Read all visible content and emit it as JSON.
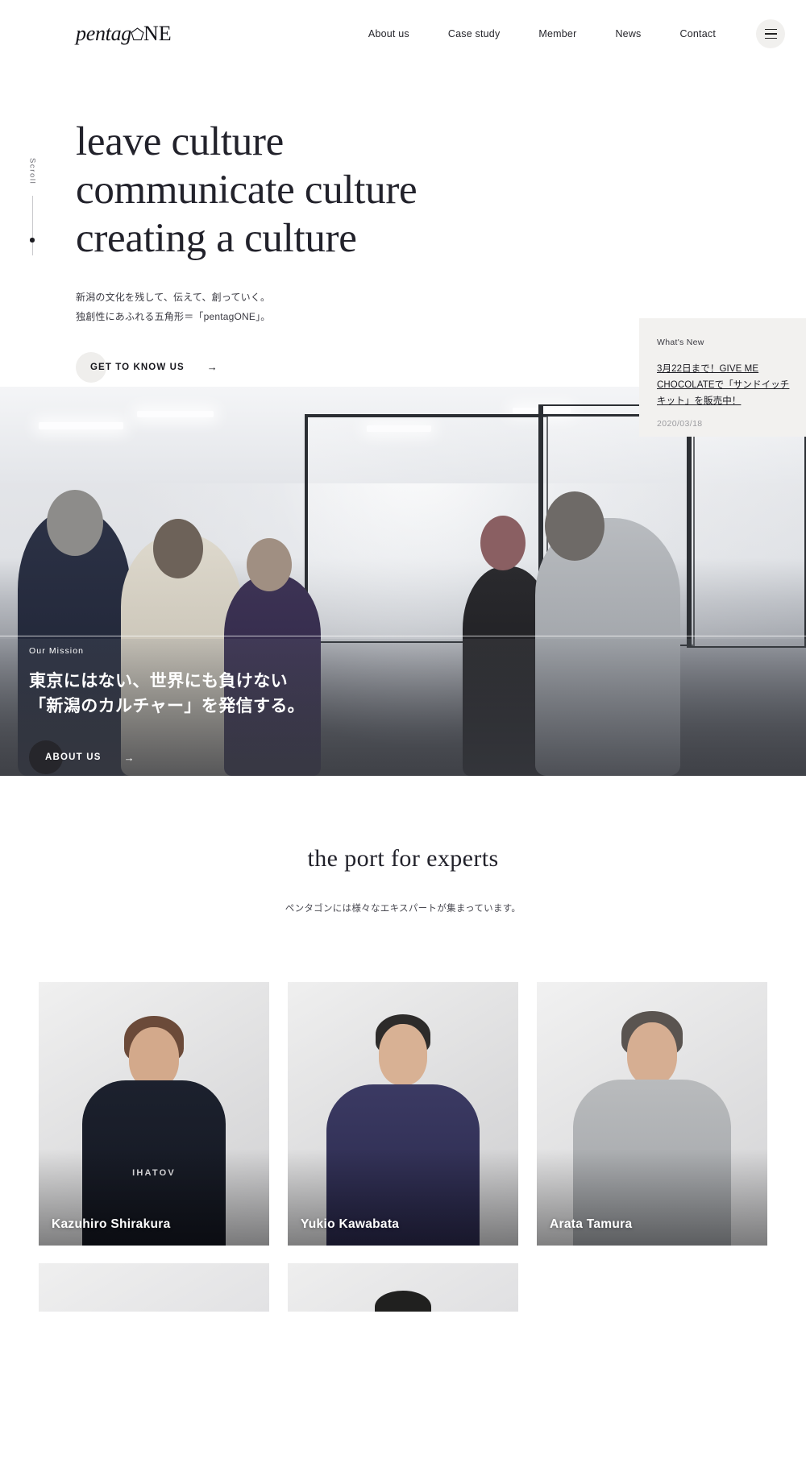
{
  "header": {
    "logo": {
      "part1": "pentag",
      "icon": "pentagon-o-icon",
      "part2": "NE"
    },
    "nav": [
      {
        "label": "About us"
      },
      {
        "label": "Case study"
      },
      {
        "label": "Member"
      },
      {
        "label": "News"
      },
      {
        "label": "Contact"
      }
    ],
    "menu_button": "menu-icon"
  },
  "hero": {
    "scroll_label": "Scroll",
    "title_line1": "leave culture",
    "title_line2": "communicate culture",
    "title_line3": "creating a culture",
    "lede_line1": "新潟の文化を残して、伝えて、創っていく。",
    "lede_line2": "独創性にあふれる五角形＝「pentagONE」。",
    "cta_label": "GET TO KNOW US",
    "cta_arrow": "→"
  },
  "whats_new": {
    "title": "What's New",
    "link_text": "3月22日まで！GIVE ME CHOCOLATEで「サンドイッチキット」を販売中！",
    "date": "2020/03/18"
  },
  "mission": {
    "eyebrow": "Our Mission",
    "headline_line1": "東京にはない、世界にも負けない",
    "headline_line2": "「新潟のカルチャー」を発信する。",
    "cta_label": "ABOUT US",
    "cta_arrow": "→"
  },
  "experts": {
    "title": "the port for experts",
    "subtitle": "ペンタゴンには様々なエキスパートが集まっています。",
    "members": [
      {
        "name": "Kazuhiro Shirakura",
        "garment_text": "IHATOV"
      },
      {
        "name": "Yukio Kawabata",
        "garment_text": ""
      },
      {
        "name": "Arata Tamura",
        "garment_text": ""
      }
    ]
  },
  "colors": {
    "accent_panel": "#f2f1ef",
    "text_primary": "#1c1c22",
    "text_muted": "#9b9b9f",
    "dark_button": "#26262b"
  }
}
